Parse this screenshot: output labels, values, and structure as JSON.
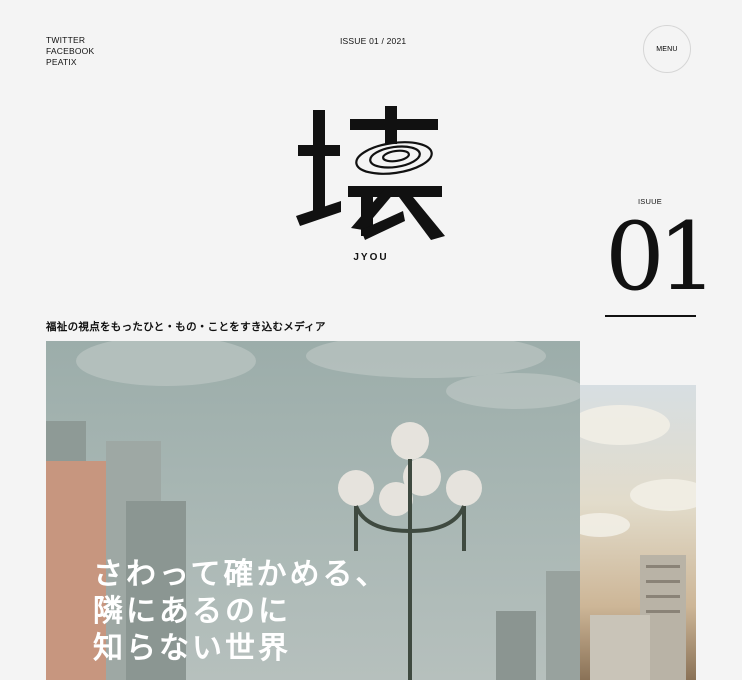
{
  "social": {
    "twitter": "TWITTER",
    "facebook": "FACEBOOK",
    "peatix": "PEATIX"
  },
  "header": {
    "issue": "ISSUE 01 / 2021",
    "menu": "MENU"
  },
  "logo": {
    "glyph": "壊",
    "sub": "JYOU"
  },
  "issue_badge": {
    "label": "ISUUE",
    "number": "01"
  },
  "tagline": "福祉の視点をもったひと・もの・ことをすき込むメディア",
  "hero": {
    "line1": "さわって確かめる、",
    "line2": "隣にあるのに",
    "line3": "知らない世界"
  }
}
